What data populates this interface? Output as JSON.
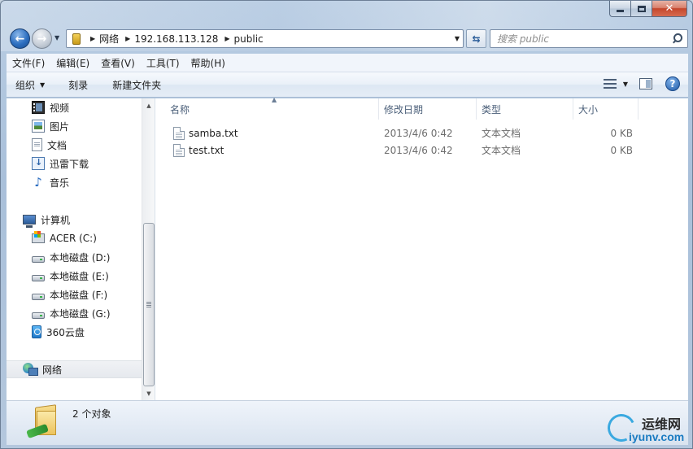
{
  "window": {
    "minimize": "",
    "maximize": "",
    "close": "✕"
  },
  "nav": {
    "breadcrumbs": [
      "网络",
      "192.168.113.128",
      "public"
    ],
    "search_placeholder": "搜索 public"
  },
  "menu": [
    "文件(F)",
    "编辑(E)",
    "查看(V)",
    "工具(T)",
    "帮助(H)"
  ],
  "commands": {
    "organize": "组织",
    "burn": "刻录",
    "new_folder": "新建文件夹"
  },
  "sidebar": {
    "libraries": [
      {
        "label": "视频",
        "icon": "video-library-icon"
      },
      {
        "label": "图片",
        "icon": "pictures-library-icon"
      },
      {
        "label": "文档",
        "icon": "documents-library-icon"
      },
      {
        "label": "迅雷下载",
        "icon": "download-folder-icon"
      },
      {
        "label": "音乐",
        "icon": "music-library-icon"
      }
    ],
    "computer": "计算机",
    "drives": [
      {
        "label": "ACER (C:)",
        "icon": "system-drive-icon"
      },
      {
        "label": "本地磁盘 (D:)",
        "icon": "hard-drive-icon"
      },
      {
        "label": "本地磁盘 (E:)",
        "icon": "hard-drive-icon"
      },
      {
        "label": "本地磁盘 (F:)",
        "icon": "hard-drive-icon"
      },
      {
        "label": "本地磁盘 (G:)",
        "icon": "hard-drive-icon"
      },
      {
        "label": "360云盘",
        "icon": "cloud-drive-icon"
      }
    ],
    "network": "网络"
  },
  "columns": {
    "name": "名称",
    "modified": "修改日期",
    "type": "类型",
    "size": "大小"
  },
  "files": [
    {
      "name": "samba.txt",
      "modified": "2013/4/6 0:42",
      "type": "文本文档",
      "size": "0 KB"
    },
    {
      "name": "test.txt",
      "modified": "2013/4/6 0:42",
      "type": "文本文档",
      "size": "0 KB"
    }
  ],
  "status": {
    "count": "2 个对象"
  },
  "watermark": {
    "cn": "运维网",
    "en": "iyunv.com"
  }
}
